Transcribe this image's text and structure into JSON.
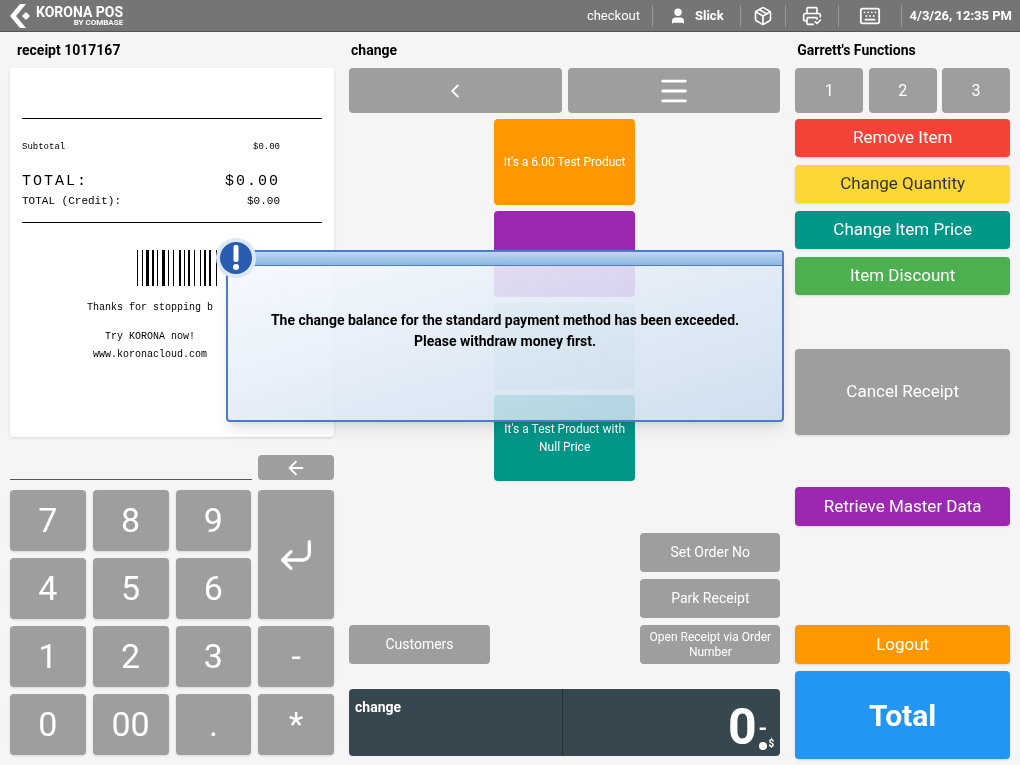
{
  "topbar": {
    "logo": "KORONA POS",
    "logo_sub": "BY COMBASE",
    "mode": "checkout",
    "user": "Slick",
    "datetime": "4/3/26, 12:35 PM"
  },
  "receipt": {
    "title": "receipt 1017167",
    "subtotal_label": "Subtotal",
    "subtotal": "$0.00",
    "total_label": "TOTAL:",
    "total": "$0.00",
    "credit_label": "TOTAL (Credit):",
    "credit": "$0.00",
    "thanks": "Thanks for stopping b",
    "try": "Try KORONA now!",
    "url": "www.koronacloud.com"
  },
  "keypad": [
    {
      "label": "7",
      "kind": "key"
    },
    {
      "label": "8",
      "kind": "key"
    },
    {
      "label": "9",
      "kind": "key"
    },
    {
      "kind": "enter"
    },
    {
      "label": "4",
      "kind": "key"
    },
    {
      "label": "5",
      "kind": "key"
    },
    {
      "label": "6",
      "kind": "key"
    },
    {
      "label": "1",
      "kind": "key"
    },
    {
      "label": "2",
      "kind": "key"
    },
    {
      "label": "3",
      "kind": "key"
    },
    {
      "label": "-",
      "kind": "key"
    },
    {
      "label": "0",
      "kind": "key"
    },
    {
      "label": "00",
      "kind": "key"
    },
    {
      "label": ".",
      "kind": "key"
    },
    {
      "label": "*",
      "kind": "key"
    }
  ],
  "middle": {
    "title": "change",
    "products": [
      {
        "kind": "tile",
        "label": "It's a 6.00 Test Product",
        "color": "#ff9800"
      },
      {
        "kind": "tile",
        "color": "#9c27b0"
      },
      {
        "kind": "covered"
      },
      {
        "kind": "tile",
        "label": "It's a Test Product with Null Price",
        "color": "#009688"
      }
    ],
    "set_order": "Set Order No",
    "park": "Park Receipt",
    "customers": "Customers",
    "open_receipt": "Open Receipt via Order Number",
    "display": {
      "label": "change",
      "amount": "0",
      "fraction": "-",
      "currency": "$"
    }
  },
  "right": {
    "title": "Garrett's Functions",
    "pages": [
      "1",
      "2",
      "3"
    ],
    "functions": [
      {
        "label": "Remove Item",
        "color": "#f44336"
      },
      {
        "label": "Change Quantity",
        "color": "#fdd835"
      },
      {
        "label": "Change Item Price",
        "color": "#009688"
      },
      {
        "label": "Item Discount",
        "color": "#4caf50"
      }
    ],
    "cancel": {
      "label": "Cancel Receipt",
      "color": "#9e9e9e"
    },
    "retrieve": {
      "label": "Retrieve Master Data",
      "color": "#9c27b0"
    },
    "logout": {
      "label": "Logout",
      "color": "#ff9800"
    },
    "total": {
      "label": "Total",
      "color": "#2196f3"
    }
  },
  "dialog": {
    "message": "The change balance for the standard payment method has been exceeded. Please withdraw money first."
  }
}
